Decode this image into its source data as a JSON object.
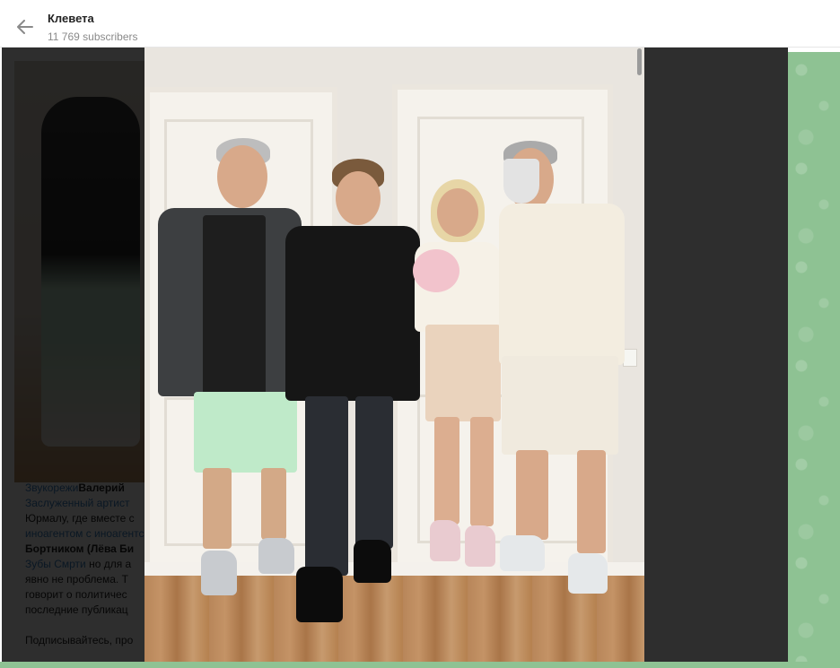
{
  "header": {
    "back_icon": "arrow-left-icon",
    "title": "Клевета",
    "subscribers": "11 769 subscribers"
  },
  "message": {
    "lines": [
      {
        "parts": [
          {
            "t": "Звукорежи",
            "s": "link"
          },
          {
            "t": "Валерий",
            "s": "bold"
          }
        ]
      },
      {
        "parts": [
          {
            "t": "Заслуженный артист",
            "s": "link"
          }
        ]
      },
      {
        "parts": [
          {
            "t": "Юрмалу, где вместе с",
            "s": "plain"
          }
        ]
      },
      {
        "parts": [
          {
            "t": "иноагентом с иноагентс",
            "s": "link"
          }
        ]
      },
      {
        "parts": [
          {
            "t": "Бортником (Лёва Би",
            "s": "bold"
          }
        ]
      },
      {
        "parts": [
          {
            "t": "Зубы Смрти",
            "s": "link"
          },
          {
            "t": " но для а",
            "s": "plain"
          }
        ]
      },
      {
        "parts": [
          {
            "t": "явно не проблема. Т",
            "s": "plain"
          }
        ]
      },
      {
        "parts": [
          {
            "t": "говорит о политичес",
            "s": "plain"
          }
        ]
      },
      {
        "parts": [
          {
            "t": "последние публикац",
            "s": "plain"
          }
        ]
      },
      {
        "parts": [
          {
            "t": "",
            "s": "plain"
          }
        ]
      },
      {
        "parts": [
          {
            "t": "Подписывайтесь, про",
            "s": "plain"
          }
        ]
      }
    ]
  },
  "colors": {
    "accent_link": "#3a7fc1",
    "wallpaper": "#8ec293",
    "overlay": "rgba(0,0,0,0.82)"
  }
}
